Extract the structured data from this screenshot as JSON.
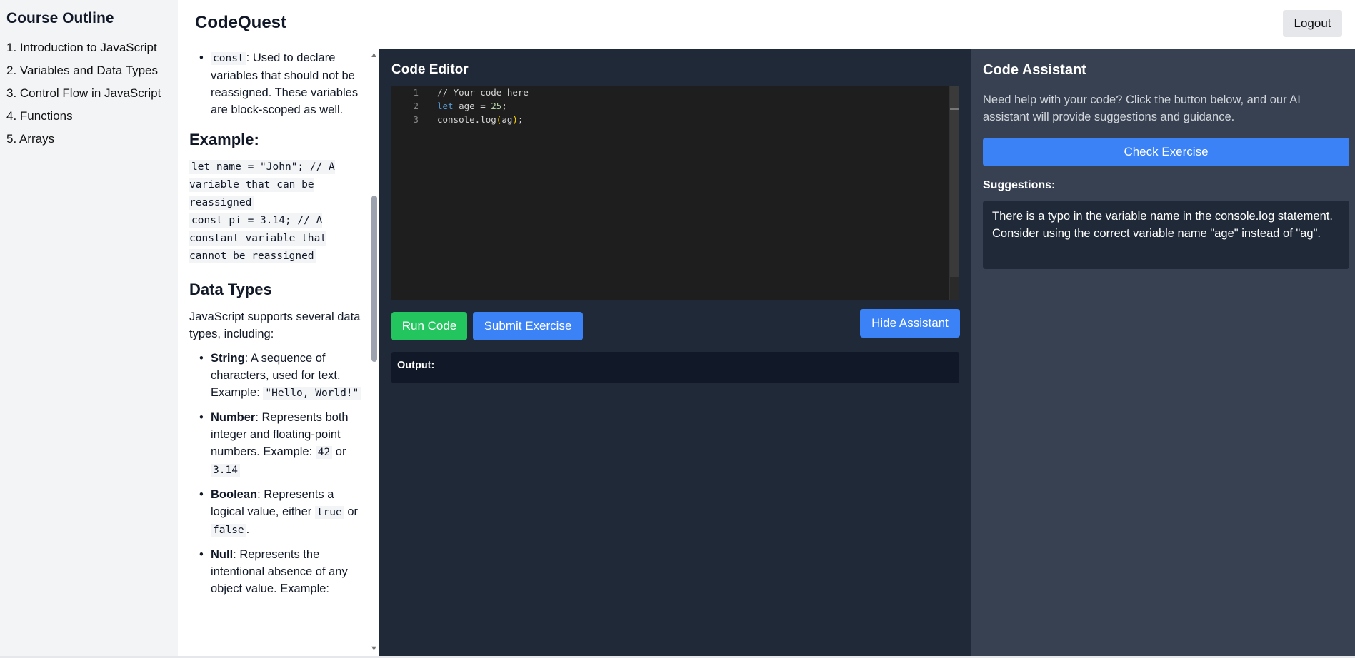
{
  "sidebar": {
    "title": "Course Outline",
    "items": [
      "1. Introduction to JavaScript",
      "2. Variables and Data Types",
      "3. Control Flow in JavaScript",
      "4. Functions",
      "5. Arrays"
    ]
  },
  "header": {
    "app_title": "CodeQuest",
    "logout_label": "Logout"
  },
  "lesson": {
    "const_item": {
      "code": "const",
      "text": ": Used to declare variables that should not be reassigned. These variables are block-scoped as well."
    },
    "example_heading": "Example:",
    "example_code": [
      "let name = \"John\"; // A variable that can be reassigned",
      "const pi = 3.14; // A constant variable that cannot be reassigned"
    ],
    "data_types_heading": "Data Types",
    "data_types_intro": "JavaScript supports several data types, including:",
    "types": [
      {
        "name": "String",
        "text": ": A sequence of characters, used for text. Example: ",
        "codes": [
          "\"Hello, World!\""
        ]
      },
      {
        "name": "Number",
        "text": ": Represents both integer and floating-point numbers. Example: ",
        "codes": [
          "42",
          "3.14"
        ],
        "joiner": " or "
      },
      {
        "name": "Boolean",
        "text": ": Represents a logical value, either ",
        "codes": [
          "true",
          "false"
        ],
        "joiner": " or ",
        "tail": "."
      },
      {
        "name": "Null",
        "text": ": Represents the intentional absence of any object value. Example:",
        "codes": []
      }
    ]
  },
  "editor": {
    "title": "Code Editor",
    "lines": [
      {
        "n": "1",
        "code": "// Your code here"
      },
      {
        "n": "2",
        "code": "let age = 25;"
      },
      {
        "n": "3",
        "code": "console.log(ag);"
      }
    ],
    "run_label": "Run Code",
    "submit_label": "Submit Exercise",
    "hide_assistant_label": "Hide Assistant",
    "output_label": "Output:"
  },
  "assistant": {
    "title": "Code Assistant",
    "description": "Need help with your code? Click the button below, and our AI assistant will provide suggestions and guidance.",
    "check_label": "Check Exercise",
    "suggestions_label": "Suggestions:",
    "suggestion_text": "There is a typo in the variable name in the console.log statement. Consider using the correct variable name \"age\" instead of \"ag\"."
  },
  "colors": {
    "run_button": "#22c55e",
    "primary_button": "#3b82f6",
    "editor_bg": "#1f2937",
    "assistant_bg": "#374151"
  }
}
